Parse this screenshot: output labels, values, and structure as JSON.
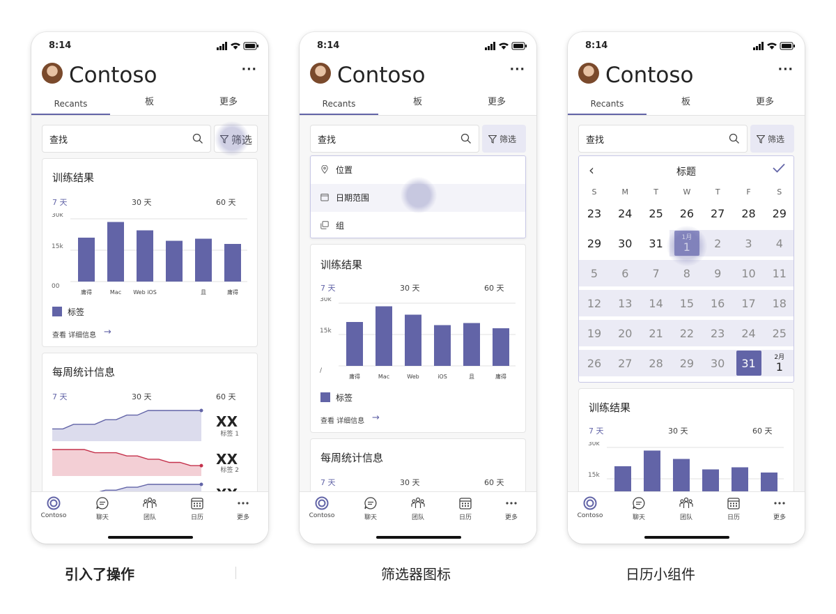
{
  "colors": {
    "accent": "#6264a7",
    "negative": "#c4314b",
    "highlight": "#e8e8f4"
  },
  "status_time": "8:14",
  "app_title": "Contoso",
  "tabs": [
    "Recants",
    "板",
    "更多"
  ],
  "search_placeholder": "查找",
  "filter_label": "筛选",
  "ranges": [
    "7 天",
    "30 天",
    "60 天"
  ],
  "training_card": {
    "title": "训练结果",
    "y_ticks": [
      "30k",
      "15k",
      "00"
    ],
    "legend": "标签",
    "details": "查看 详细信息"
  },
  "weekly_card": {
    "title": "每周统计信息",
    "stats": [
      {
        "value": "XX",
        "label": "标签 1"
      },
      {
        "value": "XX",
        "label": "标签 2"
      },
      {
        "value": "XX",
        "label": ""
      }
    ]
  },
  "dropdown_items": [
    {
      "icon": "location-icon",
      "label": "位置"
    },
    {
      "icon": "calendar-icon",
      "label": "日期范围"
    },
    {
      "icon": "group-icon",
      "label": "组"
    }
  ],
  "calendar": {
    "title": "标题",
    "weekdays": [
      "S",
      "M",
      "T",
      "W",
      "T",
      "F",
      "S"
    ],
    "rows": [
      [
        "23",
        "24",
        "25",
        "26",
        "27",
        "28",
        "29"
      ],
      [
        "29",
        "30",
        "31",
        "1",
        "2",
        "3",
        "4"
      ],
      [
        "5",
        "6",
        "7",
        "8",
        "9",
        "10",
        "11"
      ],
      [
        "12",
        "13",
        "14",
        "15",
        "16",
        "17",
        "18"
      ],
      [
        "19",
        "20",
        "21",
        "22",
        "23",
        "24",
        "25"
      ],
      [
        "26",
        "27",
        "28",
        "29",
        "30",
        "31",
        "1"
      ]
    ],
    "month_jan": "1月",
    "month_feb": "2月",
    "selected_day": "31"
  },
  "nav": [
    {
      "icon": "contoso-icon",
      "label": "Contoso"
    },
    {
      "icon": "chat-icon",
      "label": "聊天"
    },
    {
      "icon": "teams-icon",
      "label": "团队"
    },
    {
      "icon": "calendar-icon",
      "label": "日历"
    },
    {
      "icon": "more-icon",
      "label": "更多"
    }
  ],
  "captions": [
    "引入了操作",
    "筛选器图标",
    "日历小组件"
  ],
  "chart_data": [
    {
      "type": "bar",
      "title": "训练结果",
      "categories": [
        "庸得",
        "Mac",
        "Web iOS",
        "",
        "且",
        "庸得"
      ],
      "values": [
        21000,
        28500,
        24500,
        19500,
        20500,
        18000
      ],
      "ylim": [
        0,
        30000
      ],
      "yticks": [
        "30k",
        "15k",
        "00"
      ],
      "series": [
        {
          "name": "标签",
          "values": [
            21000,
            28500,
            24500,
            19500,
            20500,
            18000
          ]
        }
      ]
    },
    {
      "type": "bar",
      "title": "训练结果",
      "categories": [
        "庸得",
        "Mac",
        "Web",
        "iOS",
        "且",
        "庸得"
      ],
      "values": [
        21000,
        28500,
        24500,
        19500,
        20500,
        18000
      ],
      "ylim": [
        0,
        30000
      ],
      "yticks": [
        "30k",
        "15k",
        "/"
      ],
      "series": [
        {
          "name": "标签",
          "values": [
            21000,
            28500,
            24500,
            19500,
            20500,
            18000
          ]
        }
      ]
    },
    {
      "type": "area",
      "title": "每周统计信息",
      "series": [
        {
          "name": "标签 1",
          "values": [
            2,
            2,
            3,
            3,
            3,
            4,
            4,
            5,
            5,
            6,
            6,
            6,
            6,
            6,
            6
          ]
        },
        {
          "name": "标签 2",
          "values": [
            6,
            6,
            6,
            6,
            5,
            5,
            5,
            4,
            4,
            3,
            3,
            2,
            2,
            1,
            1
          ]
        }
      ]
    }
  ]
}
